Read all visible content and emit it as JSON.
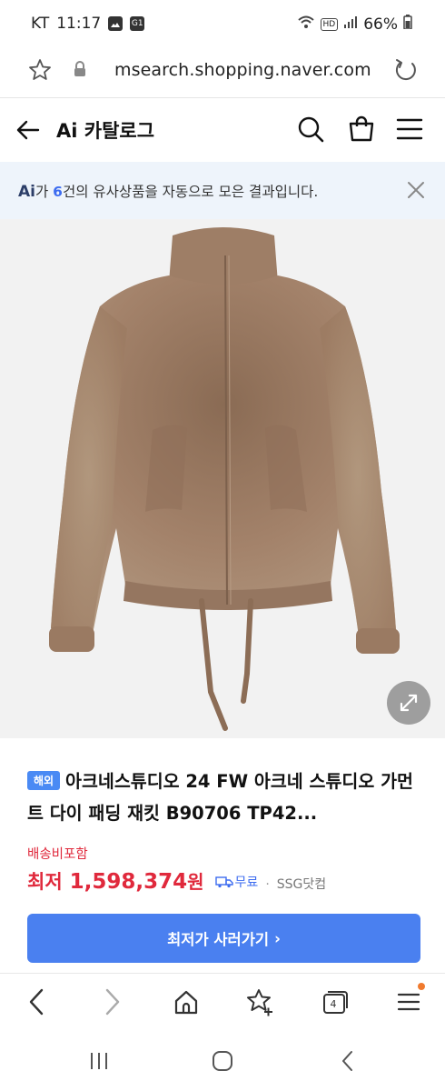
{
  "status_bar": {
    "carrier": "KT",
    "time": "11:17",
    "notif_icons": [
      "gallery-icon",
      "g1-icon"
    ],
    "g1_label": "G1",
    "hd_label": "HD",
    "battery": "66%"
  },
  "url_bar": {
    "url": "msearch.shopping.naver.com"
  },
  "header": {
    "title": "Ai 카탈로그"
  },
  "ai_banner": {
    "logo": "Ai",
    "text_before": "가 ",
    "count": "6",
    "text_after": "건의 유사상품을 자동으로 모은 결과입니다."
  },
  "product": {
    "badge": "해외",
    "title": "아크네스튜디오 24 FW 아크네 스튜디오 가먼트 다이 패딩 재킷 B90706 TP42...",
    "shipping": "배송비포함",
    "price_label": "최저",
    "price": "1,598,374",
    "price_unit": "원",
    "free_shipping": "무료",
    "separator": "·",
    "mall": "SSG닷컴",
    "buy_button": "최저가 사러가기",
    "buy_chevron": "›"
  },
  "browser_nav": {
    "tab_count": "4"
  },
  "colors": {
    "accent": "#4a80f0",
    "price": "#e0293c",
    "banner_bg": "#eef4fb",
    "jacket": "#a3826a"
  }
}
